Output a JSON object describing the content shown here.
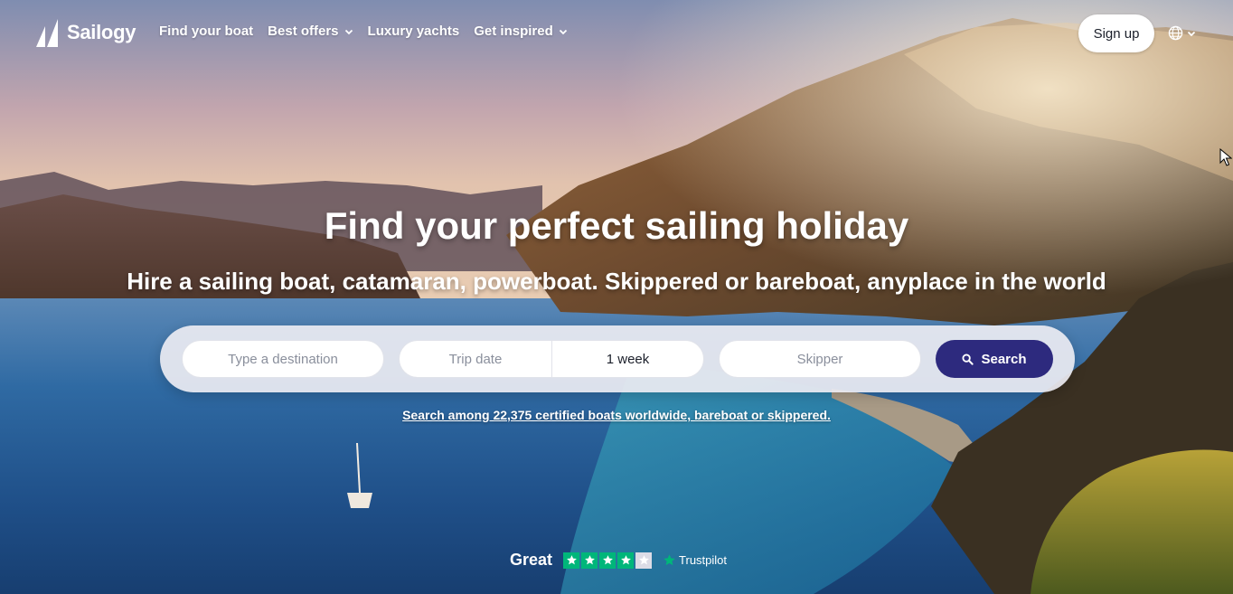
{
  "brand": {
    "name": "Sailogy"
  },
  "nav": {
    "items": [
      {
        "label": "Find your boat",
        "has_dropdown": false
      },
      {
        "label": "Best offers",
        "has_dropdown": true
      },
      {
        "label": "Luxury yachts",
        "has_dropdown": false
      },
      {
        "label": "Get inspired",
        "has_dropdown": true
      }
    ],
    "signup_label": "Sign up",
    "language_icon": "globe-icon"
  },
  "hero": {
    "title": "Find your perfect sailing holiday",
    "subtitle": "Hire a sailing boat, catamaran, powerboat. Skippered or bareboat, anyplace in the world"
  },
  "search": {
    "destination_placeholder": "Type a destination",
    "date_placeholder": "Trip date",
    "duration_value": "1 week",
    "skipper_placeholder": "Skipper",
    "button_label": "Search",
    "tagline": "Search among 22,375 certified boats worldwide, bareboat or skippered."
  },
  "trustpilot": {
    "rating_label": "Great",
    "stars_filled": 4,
    "stars_total": 5,
    "brand": "Trustpilot"
  },
  "colors": {
    "search_button": "#2d2a7e",
    "trustpilot_green": "#00b67a"
  }
}
